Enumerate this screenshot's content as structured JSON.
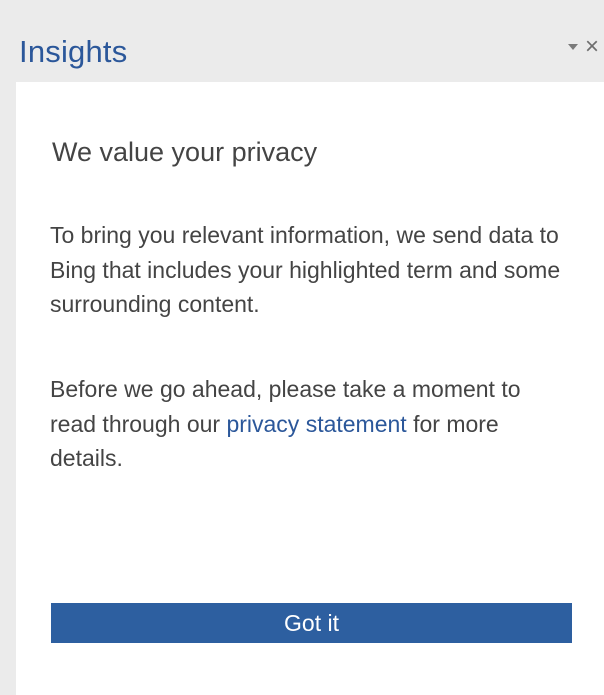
{
  "pane": {
    "title": "Insights",
    "options_icon": "chevron-down-icon",
    "close_icon": "close-icon",
    "close_glyph": "×"
  },
  "privacy_card": {
    "heading": "We value your privacy",
    "paragraph_1": "To bring you relevant information, we send data to Bing that includes your highlighted term and some surrounding content.",
    "paragraph_2_before_link": "Before we go ahead, please take a moment to read through our ",
    "link_text": "privacy statement",
    "paragraph_2_after_link": " for more details.",
    "button_label": "Got it"
  },
  "colors": {
    "accent": "#2b579a",
    "button": "#2d5fa0",
    "header_bg": "#ebebeb",
    "body_text": "#444444"
  }
}
